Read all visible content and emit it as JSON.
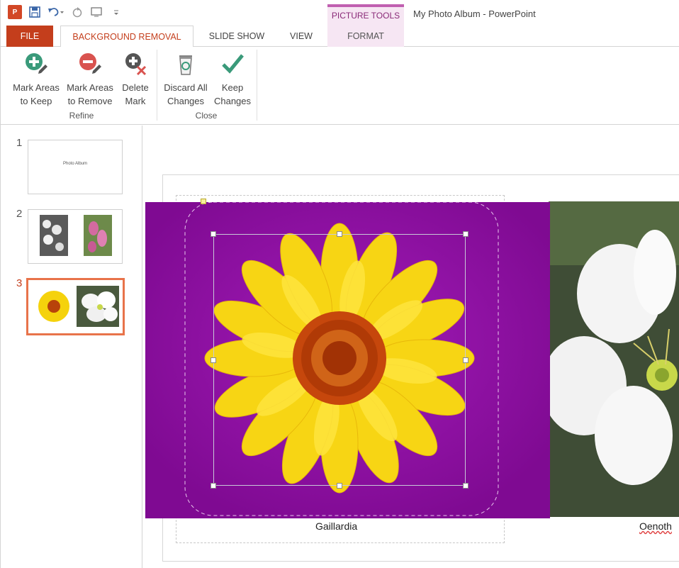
{
  "titlebar": {
    "app_logo": "P",
    "context_group": "PICTURE TOOLS",
    "window_title": "My Photo Album - PowerPoint"
  },
  "tabs": {
    "file": "FILE",
    "background_removal": "BACKGROUND REMOVAL",
    "slide_show": "SLIDE SHOW",
    "view": "VIEW",
    "format": "FORMAT"
  },
  "ribbon": {
    "mark_keep": "Mark Areas\nto Keep",
    "mark_remove": "Mark Areas\nto Remove",
    "delete_mark": "Delete\nMark",
    "discard": "Discard All\nChanges",
    "keep": "Keep\nChanges",
    "group_refine": "Refine",
    "group_close": "Close"
  },
  "thumbnails": {
    "numbers": [
      "1",
      "2",
      "3"
    ],
    "slide1_title": "Photo Album",
    "selected_index": 3
  },
  "slide": {
    "caption_left": "Gaillardia",
    "caption_right": "Oenoth"
  },
  "colors": {
    "accent": "#c43e1c",
    "context": "#c060b0",
    "removal_overlay": "#8b0e9c",
    "keep_icon": "#3a9a7a",
    "remove_icon": "#d9534f"
  },
  "icons": {
    "mark_keep": "plus-pencil-icon",
    "mark_remove": "minus-pencil-icon",
    "delete_mark": "delete-mark-icon",
    "discard": "recycle-bin-icon",
    "keep": "checkmark-icon"
  }
}
